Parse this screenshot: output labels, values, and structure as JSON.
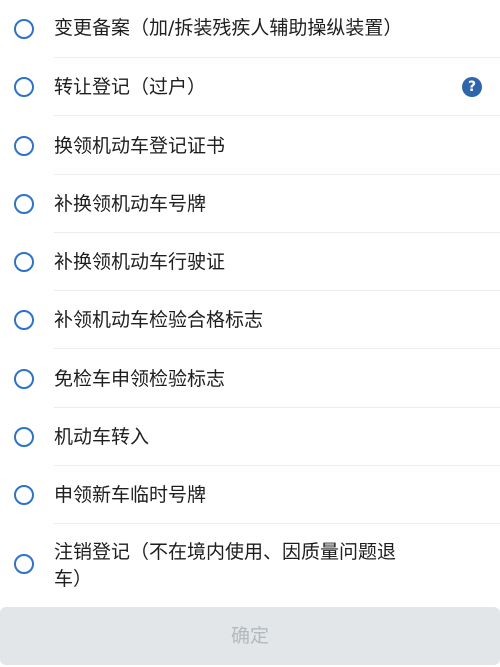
{
  "options": [
    {
      "label": "变更备案（加/拆装残疾人辅助操纵装置）",
      "selected": false,
      "has_help": false
    },
    {
      "label": "转让登记（过户）",
      "selected": false,
      "has_help": true
    },
    {
      "label": "换领机动车登记证书",
      "selected": false,
      "has_help": false
    },
    {
      "label": "补换领机动车号牌",
      "selected": false,
      "has_help": false
    },
    {
      "label": "补换领机动车行驶证",
      "selected": false,
      "has_help": false
    },
    {
      "label": "补领机动车检验合格标志",
      "selected": false,
      "has_help": false
    },
    {
      "label": "免检车申领检验标志",
      "selected": false,
      "has_help": false
    },
    {
      "label": "机动车转入",
      "selected": false,
      "has_help": false
    },
    {
      "label": "申领新车临时号牌",
      "selected": false,
      "has_help": false
    },
    {
      "label": "注销登记（不在境内使用、因质量问题退车）",
      "selected": false,
      "has_help": false
    }
  ],
  "help_icon_glyph": "?",
  "confirm_label": "确定",
  "colors": {
    "accent": "#2f73c8",
    "help_icon": "#2e66ad",
    "confirm_bg_disabled": "#e3e6e8",
    "confirm_text_disabled": "#b3b8bd"
  },
  "icons": {
    "radio": "radio-unchecked-icon",
    "help": "question-circle-icon"
  }
}
